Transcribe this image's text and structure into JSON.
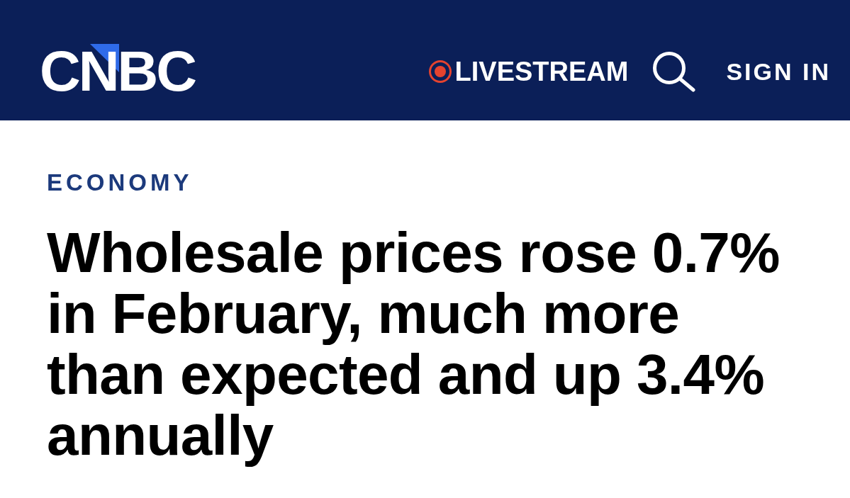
{
  "header": {
    "logo": "CNBC",
    "livestream": "LIVESTREAM",
    "sign_in": "SIGN IN"
  },
  "article": {
    "section": "ECONOMY",
    "headline": "Wholesale prices rose 0.7% in February, much more than expected and up 3.4% annually"
  }
}
